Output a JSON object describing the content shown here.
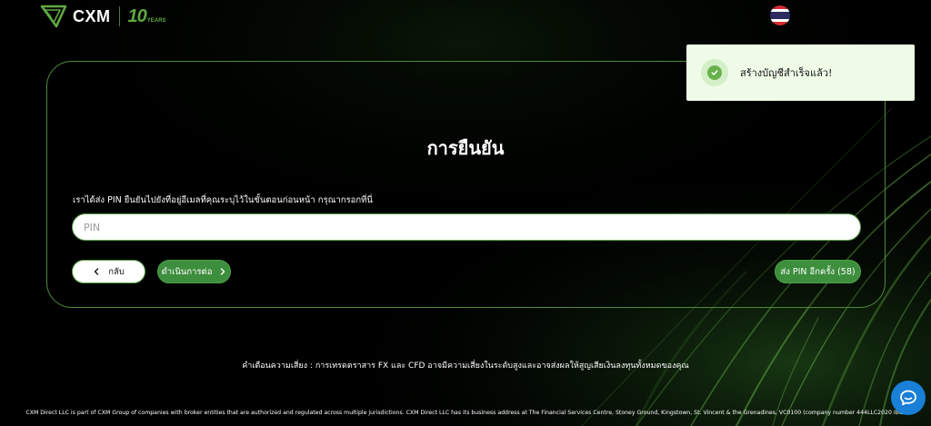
{
  "header": {
    "logo_text": "CXM",
    "anniversary_number": "10",
    "anniversary_label": "YEARS",
    "language_flag": "thailand-flag"
  },
  "toast": {
    "message": "สร้างบัญชีสำเร็จแล้ว!",
    "icon": "check-circle-icon",
    "color": "#68b24d"
  },
  "verify": {
    "title": "การยืนยัน",
    "instruction": "เราได้ส่ง PIN ยืนยันไปยังที่อยู่อีเมลที่คุณระบุไว้ในขั้นตอนก่อนหน้า กรุณากรอกที่นี่",
    "pin_placeholder": "PIN",
    "pin_value": "",
    "back_label": "กลับ",
    "continue_label": "ดำเนินการต่อ",
    "resend_label": "ส่ง PIN อีกครั้ง (58)"
  },
  "risk_warning": "คำเตือนความเสี่ยง : การเทรดตราสาร FX และ CFD อาจมีความเสี่ยงในระดับสูงและอาจส่งผลให้สูญเสียเงินลงทุนทั้งหมดของคุณ",
  "footer_text": "CXM Direct LLC is part of CXM Group of companies with broker entities that are authorized and regulated across multiple jurisdictions. CXM Direct LLC has its business address at The Financial Services Centre, Stoney Ground, Kingstown, St. Vincent & the Grenadines, VC0100    (company number 444LLC2020 IBC)",
  "colors": {
    "brand_green": "#3d8e3d",
    "accent_green": "#5aa548",
    "chat_blue": "#1a7fd6"
  }
}
